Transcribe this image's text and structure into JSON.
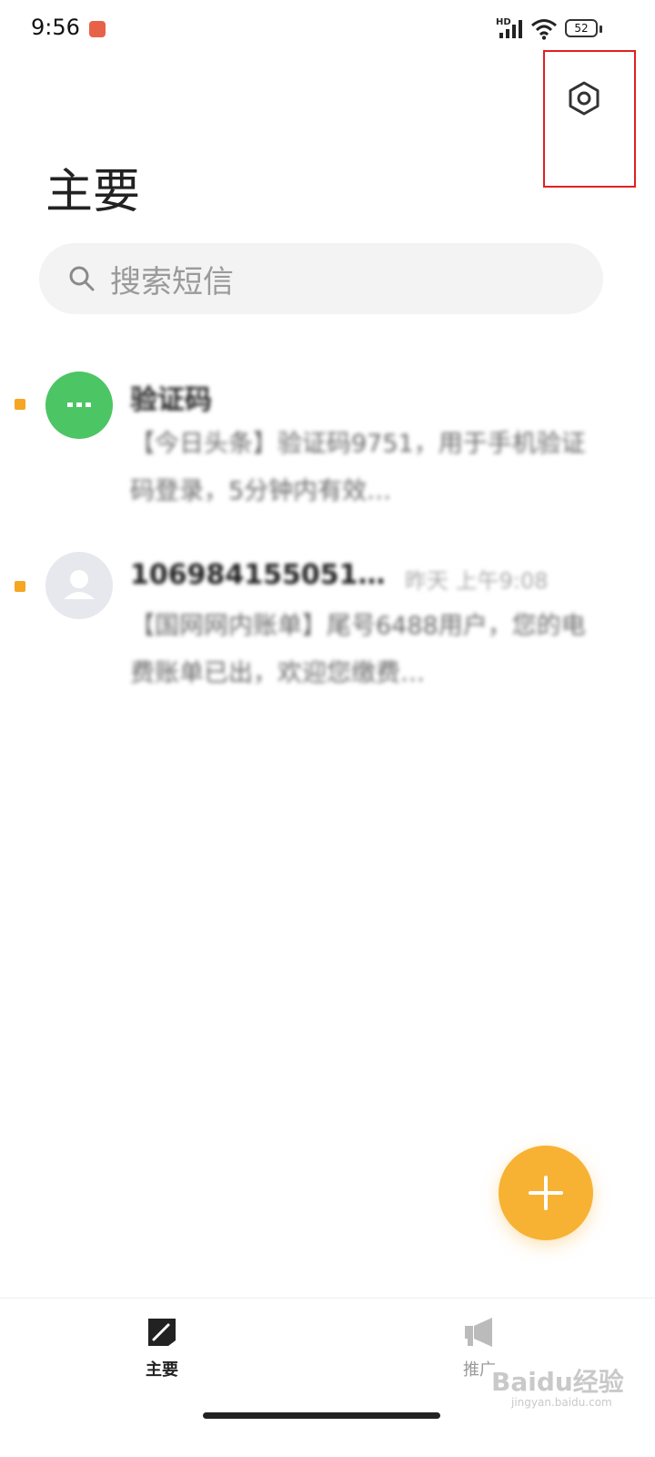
{
  "status_bar": {
    "time": "9:56",
    "network_badge": "HD",
    "battery_level": "52"
  },
  "header": {
    "title": "主要",
    "settings_icon": "hexagon-gear-icon"
  },
  "search": {
    "placeholder": "搜索短信"
  },
  "conversations": [
    {
      "sender": "验证码",
      "preview": "【今日头条】验证码9751，用于手机验证码登录，5分钟内有效…",
      "avatar_color": "#4cc564",
      "unread": true
    },
    {
      "sender": "106984155051…",
      "meta": "昨天 上午9:08",
      "preview": "【国网网内账单】尾号6488用户，您的电费账单已出，欢迎您缴费…",
      "avatar_color": "#e7e7ee",
      "unread": true
    }
  ],
  "fab": {
    "icon": "plus-icon",
    "color": "#f7b234"
  },
  "bottom_nav": {
    "tabs": [
      {
        "label": "主要",
        "icon": "compose-note-icon",
        "active": true
      },
      {
        "label": "推广",
        "icon": "megaphone-icon",
        "active": false
      }
    ]
  },
  "watermark": {
    "text": "Baidu经验",
    "sub": "jingyan.baidu.com"
  },
  "colors": {
    "accent": "#f7b234",
    "highlight_box": "#e02020",
    "unread_dot": "#f5a623"
  }
}
